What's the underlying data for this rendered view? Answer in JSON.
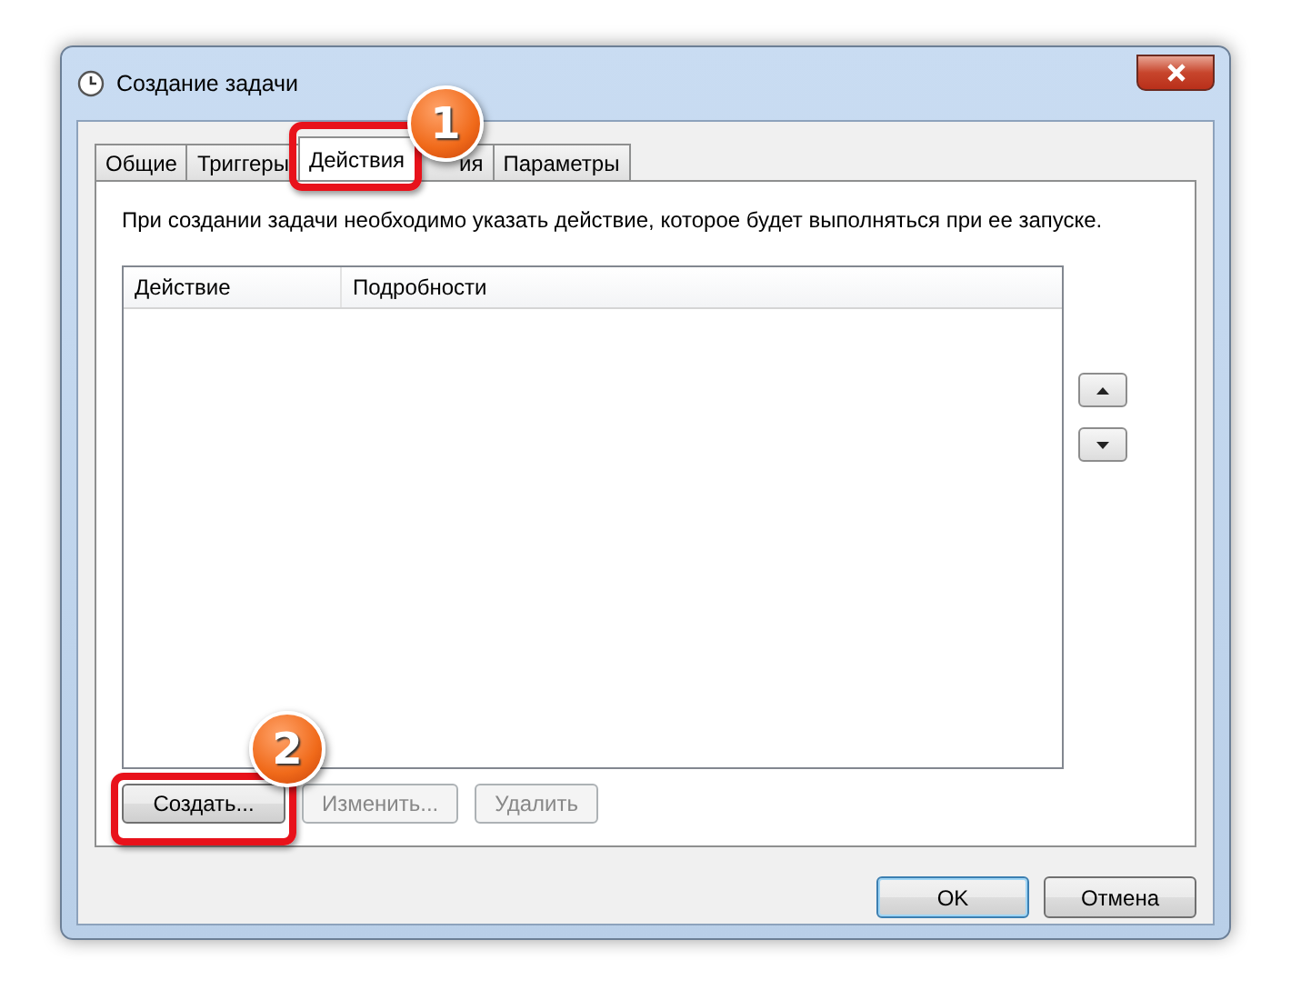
{
  "window": {
    "title": "Создание задачи"
  },
  "tabs": [
    {
      "label": "Общие",
      "selected": false
    },
    {
      "label": "Триггеры",
      "selected": false
    },
    {
      "label": "Действия",
      "selected": true
    },
    {
      "label": "ия",
      "selected": false
    },
    {
      "label": "Параметры",
      "selected": false
    }
  ],
  "description": "При создании задачи необходимо указать действие, которое будет выполняться при ее запуске.",
  "table": {
    "columns": [
      "Действие",
      "Подробности"
    ]
  },
  "action_buttons": [
    {
      "label": "Создать...",
      "disabled": false
    },
    {
      "label": "Изменить...",
      "disabled": true
    },
    {
      "label": "Удалить",
      "disabled": true
    }
  ],
  "dialog_buttons": [
    {
      "label": "OK",
      "default": true
    },
    {
      "label": "Отмена",
      "default": false
    }
  ],
  "annotations": [
    {
      "number": "1"
    },
    {
      "number": "2"
    }
  ]
}
